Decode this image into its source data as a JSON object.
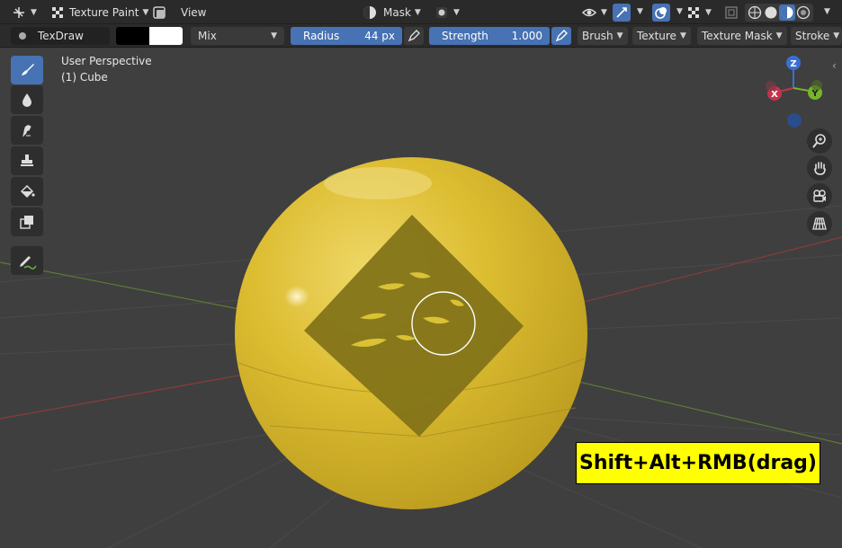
{
  "header": {
    "mode_label": "Texture Paint",
    "view_menu": "View",
    "mask_label": "Mask"
  },
  "toolsettings": {
    "brush_name": "TexDraw",
    "blend_mode": "Mix",
    "radius_label": "Radius",
    "radius_value": "44 px",
    "strength_label": "Strength",
    "strength_value": "1.000",
    "brush_menu": "Brush",
    "texture_menu": "Texture",
    "texture_mask_menu": "Texture Mask",
    "stroke_menu": "Stroke",
    "color_primary": "#000000",
    "color_secondary": "#ffffff"
  },
  "viewport": {
    "view_name": "User Perspective",
    "object_name": "(1) Cube"
  },
  "gizmo": {
    "z": "Z",
    "x": "X",
    "y": "Y"
  },
  "toolbar_icons": [
    "draw-brush-icon",
    "soften-icon",
    "smear-icon",
    "clone-icon",
    "fill-icon",
    "mask-icon",
    "annotate-icon"
  ],
  "nav_icons": [
    "zoom-icon",
    "pan-hand-icon",
    "camera-icon",
    "grid-view-icon"
  ],
  "shortcut": {
    "text": "Shift+Alt+RMB(drag)"
  },
  "colors": {
    "accent": "#4772b3",
    "sphere": "#d9b82c",
    "highlight_box": "#ffff00"
  }
}
